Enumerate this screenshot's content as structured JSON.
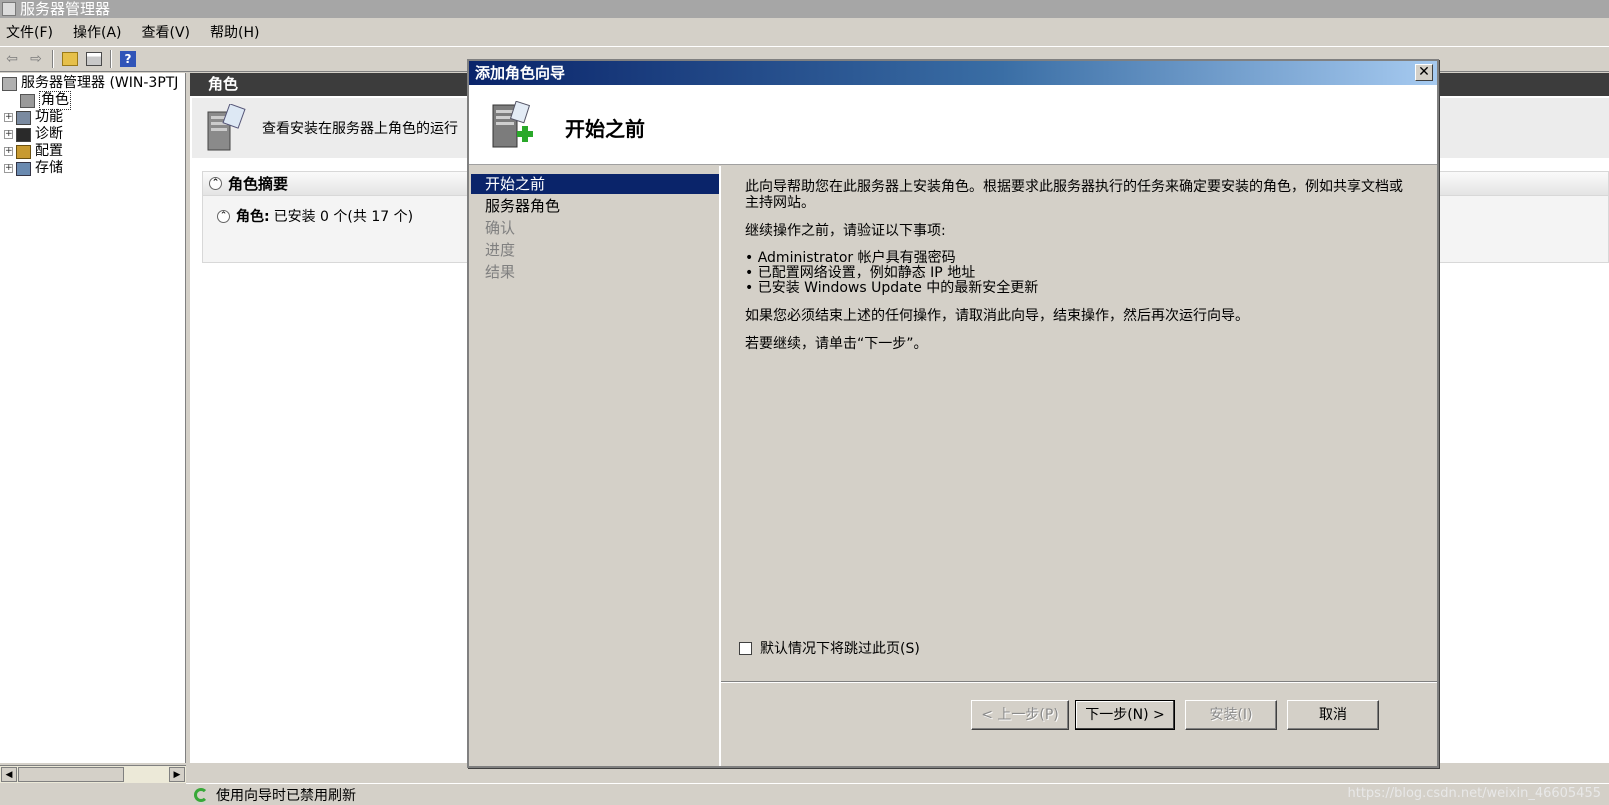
{
  "app": {
    "title": "服务器管理器"
  },
  "menu": [
    "文件(F)",
    "操作(A)",
    "查看(V)",
    "帮助(H)"
  ],
  "toolbar": {
    "back_icon": "back-arrow-icon",
    "forward_icon": "forward-arrow-icon",
    "help_label": "?"
  },
  "tree": {
    "root": "服务器管理器 (WIN-3PTJ",
    "items": [
      {
        "label": "角色",
        "icon": "roles-icon",
        "selected": true
      },
      {
        "label": "功能",
        "icon": "features-icon",
        "expand": "+"
      },
      {
        "label": "诊断",
        "icon": "diagnostics-icon",
        "expand": "+"
      },
      {
        "label": "配置",
        "icon": "configuration-icon",
        "expand": "+"
      },
      {
        "label": "存储",
        "icon": "storage-icon",
        "expand": "+"
      }
    ]
  },
  "content": {
    "header": "角色",
    "description": "查看安装在服务器上角色的运行",
    "section_title": "角色摘要",
    "roles_label": "角色:",
    "roles_value": "已安装 0 个(共 17 个)"
  },
  "status": {
    "text": "使用向导时已禁用刷新",
    "watermark": "https://blog.csdn.net/weixin_46605455"
  },
  "wizard": {
    "title": "添加角色向导",
    "close_label": "✕",
    "heading": "开始之前",
    "nav": [
      {
        "label": "开始之前",
        "state": "active"
      },
      {
        "label": "服务器角色",
        "state": "enabled"
      },
      {
        "label": "确认",
        "state": "disabled"
      },
      {
        "label": "进度",
        "state": "disabled"
      },
      {
        "label": "结果",
        "state": "disabled"
      }
    ],
    "intro": "此向导帮助您在此服务器上安装角色。根据要求此服务器执行的任务来确定要安装的角色，例如共享文档或主持网站。",
    "verify": "继续操作之前，请验证以下事项:",
    "bullets": [
      "Administrator 帐户具有强密码",
      "已配置网络设置，例如静态 IP 地址",
      "已安装 Windows Update 中的最新安全更新"
    ],
    "cancel_note": "如果您必须结束上述的任何操作，请取消此向导，结束操作，然后再次运行向导。",
    "continue_note": "若要继续，请单击“下一步”。",
    "skip_checkbox": "默认情况下将跳过此页(S)",
    "buttons": {
      "prev": "< 上一步(P)",
      "next": "下一步(N) >",
      "install": "安装(I)",
      "cancel": "取消"
    }
  }
}
